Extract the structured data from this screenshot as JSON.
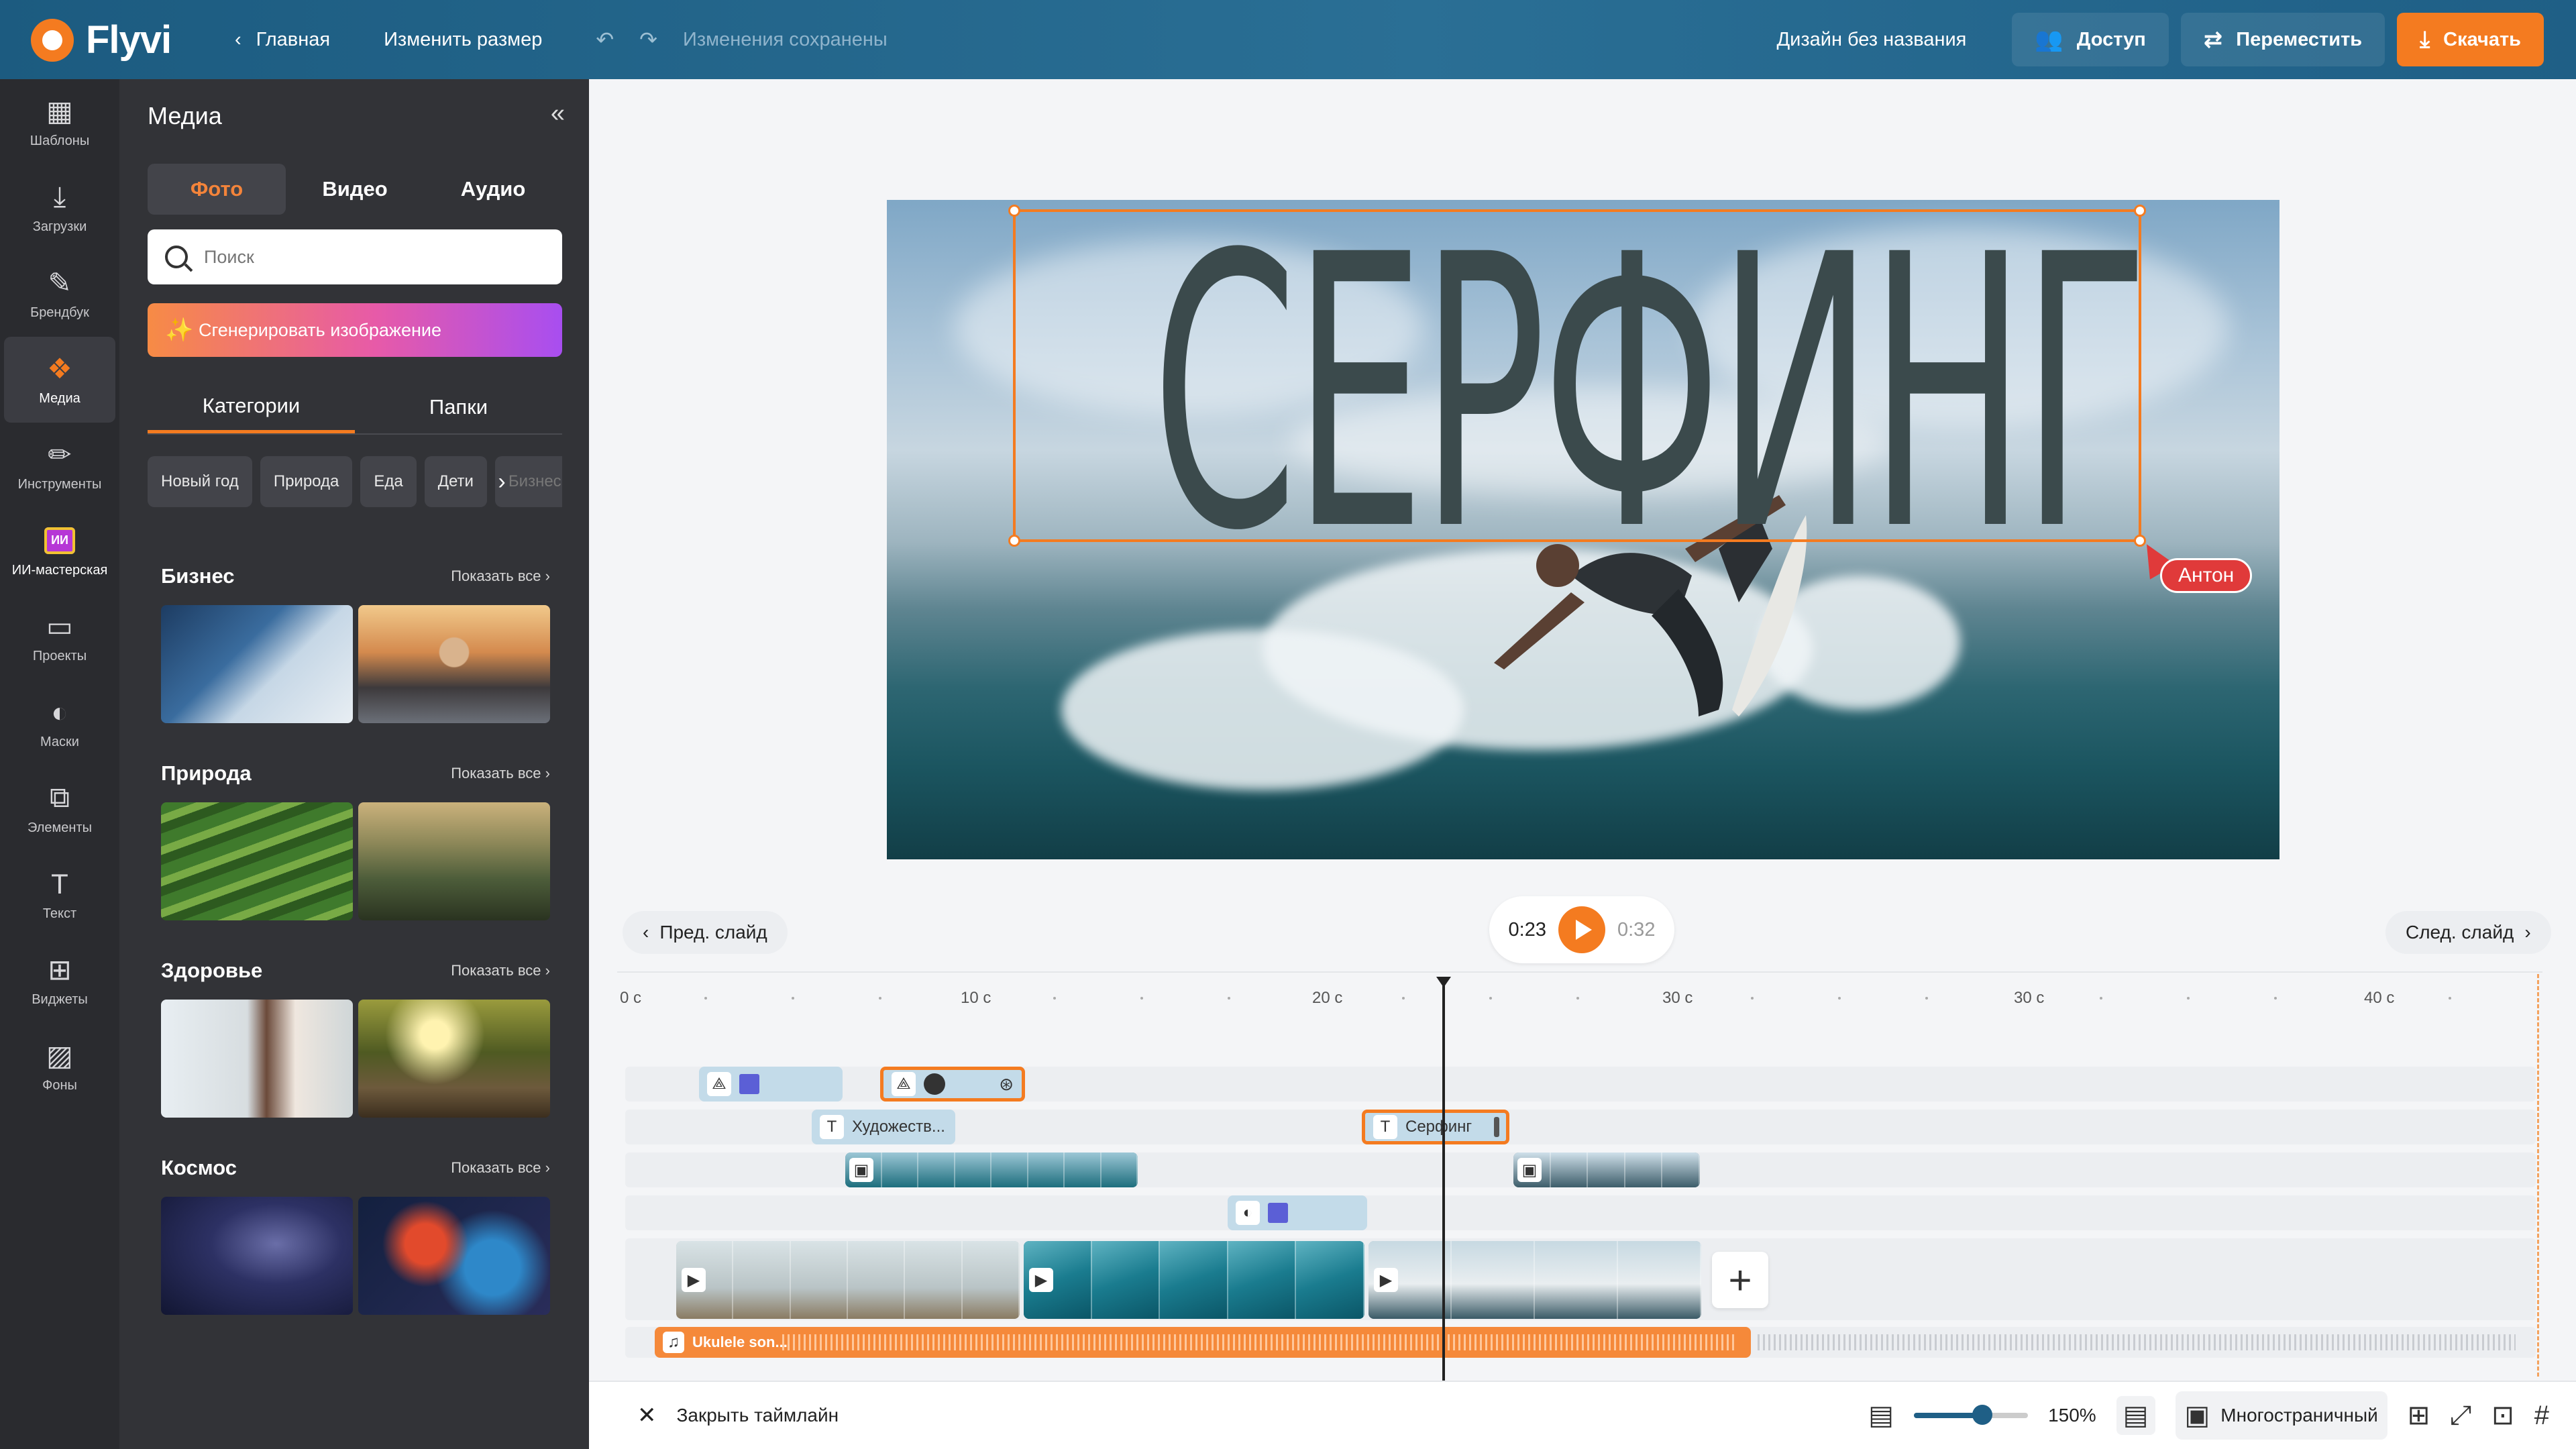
{
  "app": {
    "name": "Flyvi",
    "brand_color": "#f47b20",
    "header_color": "#1f5f86"
  },
  "topbar": {
    "home": "Главная",
    "resize": "Изменить размер",
    "saved_status": "Изменения сохранены",
    "design_title": "Дизайн без названия",
    "access": "Доступ",
    "move": "Переместить",
    "download": "Скачать"
  },
  "rail": {
    "items": [
      {
        "label": "Шаблоны",
        "icon": "layout-icon"
      },
      {
        "label": "Загрузки",
        "icon": "download-icon"
      },
      {
        "label": "Брендбук",
        "icon": "brandbook-icon"
      },
      {
        "label": "Медиа",
        "icon": "media-icon"
      },
      {
        "label": "Инструменты",
        "icon": "pencil-icon"
      },
      {
        "label": "ИИ-мастерская",
        "icon": "ai-chip-icon"
      },
      {
        "label": "Проекты",
        "icon": "folder-icon"
      },
      {
        "label": "Маски",
        "icon": "mask-icon"
      },
      {
        "label": "Элементы",
        "icon": "elements-icon"
      },
      {
        "label": "Текст",
        "icon": "text-icon"
      },
      {
        "label": "Виджеты",
        "icon": "widgets-icon"
      },
      {
        "label": "Фоны",
        "icon": "backgrounds-icon"
      }
    ],
    "ai_badge": "ИИ"
  },
  "panel": {
    "title": "Медиа",
    "tabs": [
      "Фото",
      "Видео",
      "Аудио"
    ],
    "search_placeholder": "Поиск",
    "generate": "Сгенерировать изображение",
    "subtabs": [
      "Категории",
      "Папки"
    ],
    "chips": [
      "Новый год",
      "Природа",
      "Еда",
      "Дети",
      "Бизнес"
    ],
    "show_all": "Показать все",
    "sections": [
      "Бизнес",
      "Природа",
      "Здоровье",
      "Космос"
    ]
  },
  "canvas": {
    "headline": "СЕРФИНГ",
    "collaborator": "Антон"
  },
  "controls": {
    "prev_slide": "Пред. слайд",
    "next_slide": "След. слайд",
    "current_time": "0:23",
    "total_time": "0:32"
  },
  "timeline": {
    "ruler": [
      "0 с",
      "10 с",
      "20 с",
      "30 с",
      "30 с",
      "40 с"
    ],
    "text_clip_1": "Художеств...",
    "text_clip_2": "Серфинг",
    "audio_clip": "Ukulele son..."
  },
  "bottombar": {
    "close_timeline": "Закрыть таймлайн",
    "zoom": "150%",
    "zoom_level": 0.6,
    "multipage": "Многостраничный"
  }
}
